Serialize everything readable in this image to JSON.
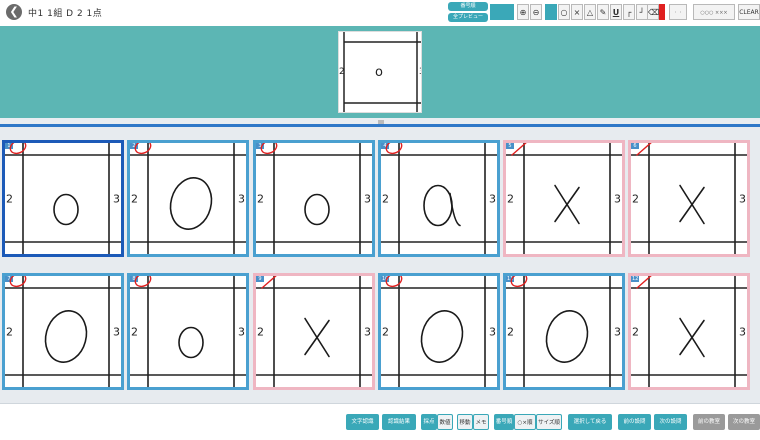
{
  "header": {
    "back_icon": "back-arrow-icon",
    "title": "中1  1組  D 2  1点"
  },
  "toolbar": {
    "stack_top": "番号順",
    "stack_bottom": "全プレビュー",
    "zoom_in": "⊕",
    "zoom_out": "⊖",
    "mark_circle": "○",
    "mark_cross": "×",
    "mark_triangle": "△",
    "underline": "U",
    "clear_label": "CLEAR",
    "mini_marks": "○○○ ×××",
    "accent_color": "#3aa8b8",
    "pen_color": "#e02020"
  },
  "preview": {
    "left_digit": "2",
    "right_digit": "3",
    "answer_text": "o"
  },
  "answers": [
    {
      "num": "1",
      "status": "correct",
      "shape": "o-small",
      "selected": true
    },
    {
      "num": "2",
      "status": "correct",
      "shape": "o-large",
      "selected": false
    },
    {
      "num": "3",
      "status": "correct",
      "shape": "o-small",
      "selected": false
    },
    {
      "num": "4",
      "status": "correct",
      "shape": "a",
      "selected": false
    },
    {
      "num": "5",
      "status": "wrong",
      "shape": "x",
      "selected": false
    },
    {
      "num": "6",
      "status": "wrong",
      "shape": "x",
      "selected": false
    },
    {
      "num": "7",
      "status": "correct",
      "shape": "o-large",
      "selected": false
    },
    {
      "num": "8",
      "status": "correct",
      "shape": "o-small",
      "selected": false
    },
    {
      "num": "9",
      "status": "wrong",
      "shape": "x",
      "selected": false
    },
    {
      "num": "10",
      "status": "correct",
      "shape": "o-large",
      "selected": false
    },
    {
      "num": "11",
      "status": "correct",
      "shape": "o-large",
      "selected": false
    },
    {
      "num": "12",
      "status": "wrong",
      "shape": "x",
      "selected": false
    }
  ],
  "cell_digits": {
    "left": "2",
    "right": "3"
  },
  "colors": {
    "correct_border": "#4aa0d0",
    "wrong_border": "#efb6c2",
    "selected_border": "#1c5ab8",
    "banner": "#5cb6b4",
    "mark_red": "#e02020"
  },
  "footer": {
    "btn_text_recog": "文字認識",
    "btn_recog_result": "認識結果",
    "seg_a": "採点",
    "seg_b": "数値",
    "seg_c": "移動",
    "seg_d": "メモ",
    "seg_e": "番号順",
    "seg_f": "○×順",
    "seg_g": "サイズ順",
    "btn_select_return": "選択して戻る",
    "btn_prev_q": "前の設問",
    "btn_next_q": "次の設問",
    "btn_prev_class": "前の教室",
    "btn_next_class": "次の教室"
  }
}
